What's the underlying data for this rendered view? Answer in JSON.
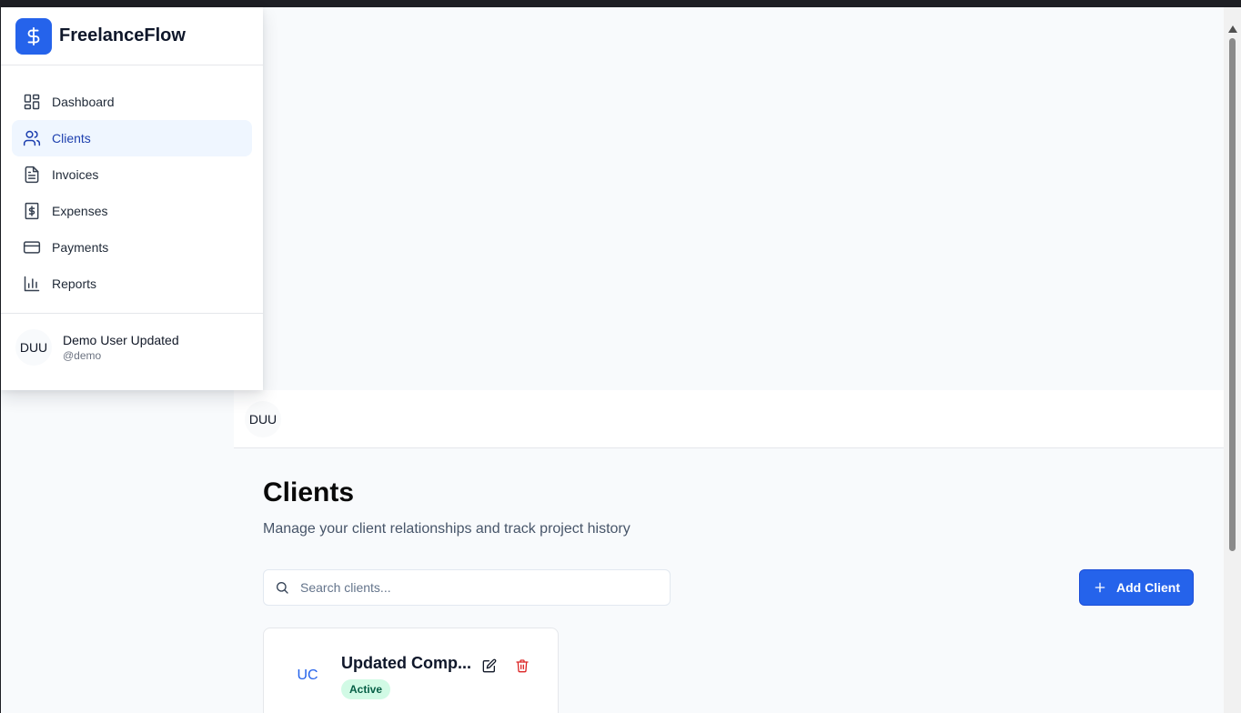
{
  "brand": {
    "name": "FreelanceFlow",
    "logo_icon": "dollar-icon",
    "accent": "#2563eb"
  },
  "sidebar": {
    "items": [
      {
        "label": "Dashboard",
        "icon": "dashboard-icon",
        "active": false
      },
      {
        "label": "Clients",
        "icon": "users-icon",
        "active": true
      },
      {
        "label": "Invoices",
        "icon": "file-text-icon",
        "active": false
      },
      {
        "label": "Expenses",
        "icon": "receipt-icon",
        "active": false
      },
      {
        "label": "Payments",
        "icon": "credit-card-icon",
        "active": false
      },
      {
        "label": "Reports",
        "icon": "bar-chart-icon",
        "active": false
      }
    ],
    "user": {
      "initials": "DUU",
      "name": "Demo User Updated",
      "handle": "@demo"
    }
  },
  "header": {
    "avatar_initials": "DUU"
  },
  "main": {
    "title": "Clients",
    "subtitle": "Manage your client relationships and track project history",
    "search": {
      "placeholder": "Search clients...",
      "value": ""
    },
    "add_button_label": "Add Client",
    "clients": [
      {
        "initials": "UC",
        "name": "Updated Comp...",
        "status": "Active",
        "status_color": "#d1fae5"
      }
    ]
  }
}
